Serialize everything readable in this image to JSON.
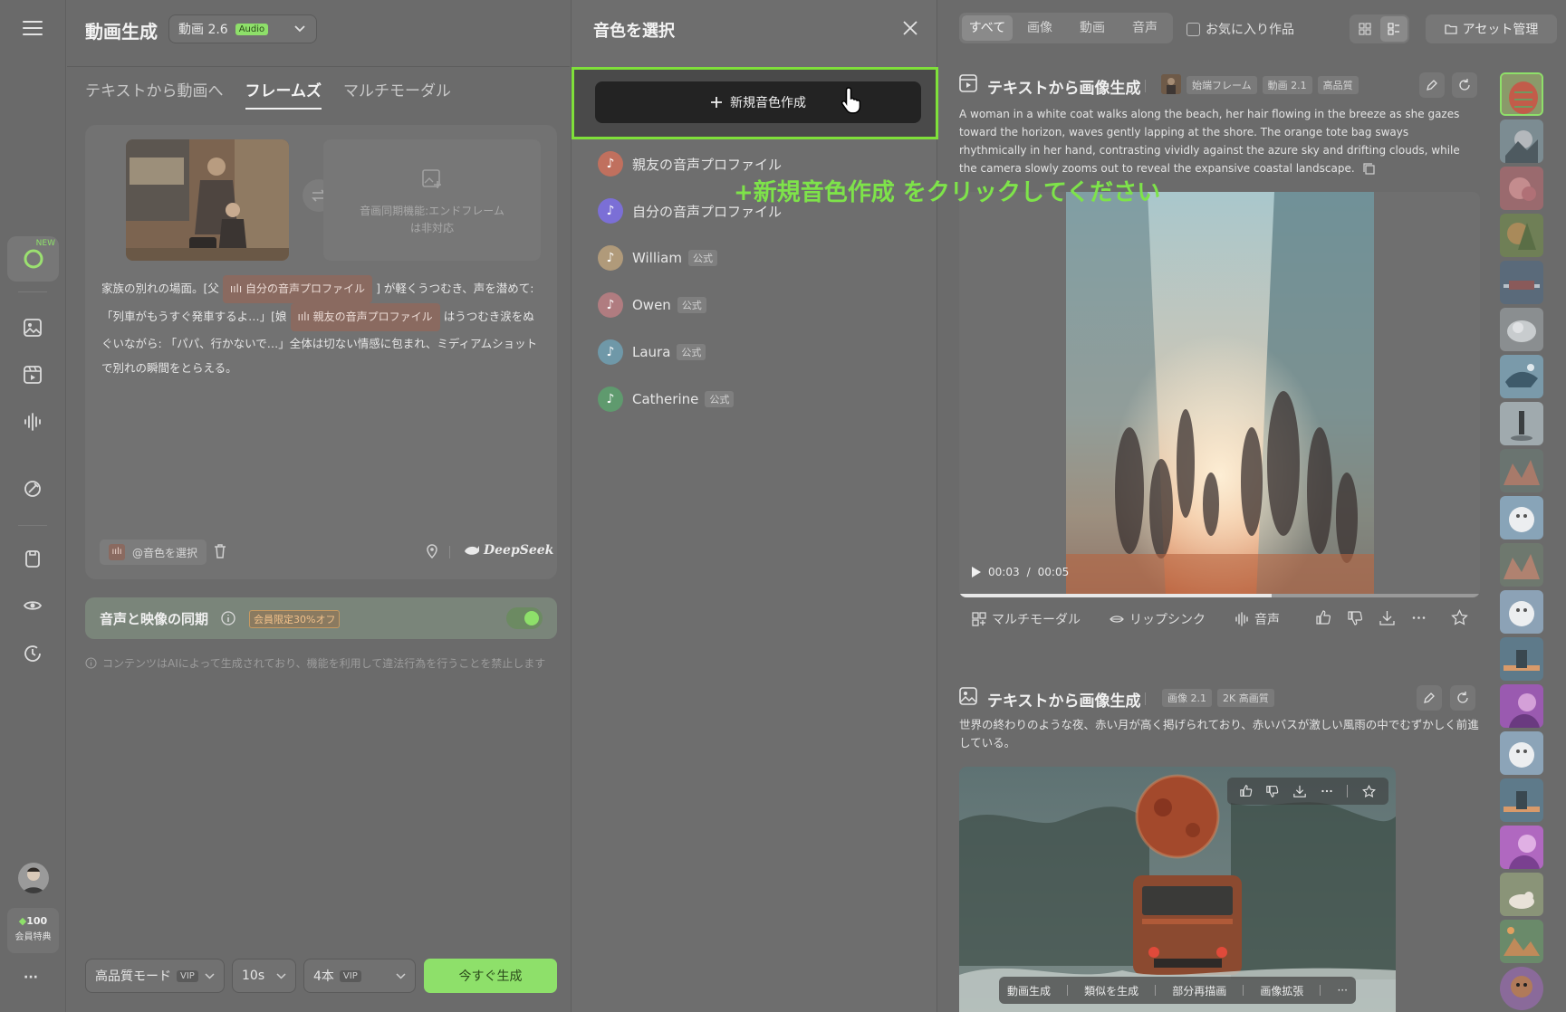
{
  "app": {
    "title": "動画生成",
    "model_label": "動画 2.6",
    "model_badge": "Audio"
  },
  "left_tabs": [
    "テキストから動画へ",
    "フレームズ",
    "マルチモーダル"
  ],
  "frames": {
    "end_frame_note_line1": "音画同期機能:エンドフレーム",
    "end_frame_note_line2": "は非対応"
  },
  "prompt": {
    "part1": "家族の別れの場面。[父",
    "tag1": "自分の音声プロファイル",
    "part2": "] が軽くうつむき、声を潜めて: 「列車がもうすぐ発車するよ…」[娘",
    "tag2": "親友の音声プロファイル",
    "part3": "はうつむき涙をぬぐいながら: 「パパ、行かないで…」全体は切ない情感に包まれ、ミディアムショットで別れの瞬間をとらえる。"
  },
  "prompt_toolbar": {
    "select_voice": "@音色を選択",
    "deepseek": "DeepSeek"
  },
  "sync": {
    "label": "音声と映像の同期",
    "promo": "会員限定30%オフ",
    "enabled": true
  },
  "disclaimer": "コンテンツはAIによって生成されており、機能を利用して違法行為を行うことを禁止します",
  "bottom_bar": {
    "quality": "高品質モード",
    "quality_badge": "VIP",
    "duration": "10s",
    "count": "4本",
    "count_badge": "VIP",
    "generate": "今すぐ生成"
  },
  "sidebar": {
    "new_badge": "NEW",
    "credits": "100",
    "credits_label": "会員特典",
    "more": "···"
  },
  "voice_panel": {
    "title": "音色を選択",
    "create_button": "新規音色作成",
    "instruction": "+新規音色作成 をクリックしてください",
    "official_label": "公式",
    "voices": [
      {
        "name": "親友の音声プロファイル",
        "official": false,
        "color": "#c0705e"
      },
      {
        "name": "自分の音声プロファイル",
        "official": false,
        "color": "#7b6fd6"
      },
      {
        "name": "William",
        "official": true,
        "color": "#b09a7a"
      },
      {
        "name": "Owen",
        "official": true,
        "color": "#b07c80"
      },
      {
        "name": "Laura",
        "official": true,
        "color": "#6f98a8"
      },
      {
        "name": "Catherine",
        "official": true,
        "color": "#5f9a6e"
      }
    ]
  },
  "filter_bar": {
    "tabs": [
      "すべて",
      "画像",
      "動画",
      "音声"
    ],
    "favorites": "お気に入り作品",
    "asset_manage": "アセット管理"
  },
  "card1": {
    "title": "テキストから画像生成",
    "tags": [
      "始端フレーム",
      "動画 2.1",
      "高品質"
    ],
    "description": "A woman in a white coat walks along the beach, her hair flowing in the breeze as she gazes toward the horizon, waves gently lapping at the shore. The orange tote bag sways rhythmically in her hand, contrasting vividly against the azure sky and drifting clouds, while the camera slowly zooms out to reveal the expansive coastal landscape.",
    "time_current": "00:03",
    "time_total": "00:05",
    "progress": 0.6,
    "actions": [
      "マルチモーダル",
      "リップシンク",
      "音声"
    ]
  },
  "card2": {
    "title": "テキストから画像生成",
    "tags": [
      "画像 2.1",
      "2K 高画質"
    ],
    "description": "世界の終わりのような夜、赤い月が高く掲げられており、赤いバスが激しい風雨の中でむずかしく前進している。",
    "overlay_actions": [
      "動画生成",
      "類似を生成",
      "部分再描画",
      "画像拡張",
      "···"
    ]
  },
  "colors": {
    "accent_green": "#8ee06a",
    "highlight_border": "#7fe03a",
    "instruction_green": "#7ee34a"
  }
}
